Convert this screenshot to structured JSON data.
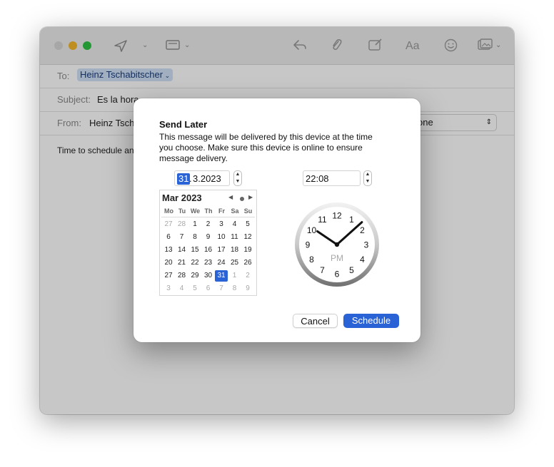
{
  "compose": {
    "to_label": "To:",
    "to_recipient": "Heinz Tschabitscher",
    "subject_label": "Subject:",
    "subject_value": "Es la hora",
    "from_label": "From:",
    "from_value": "Heinz Tsch",
    "from_account_suffix": "one",
    "body_preview": "Time to schedule an"
  },
  "dialog": {
    "title": "Send Later",
    "message": "This message will be delivered by this device at the time you choose. Make sure this device is online to ensure message delivery.",
    "date_day": "31",
    "date_sep": ".",
    "date_rest": " 3.2023",
    "time_value": "22:08",
    "cancel_label": "Cancel",
    "schedule_label": "Schedule"
  },
  "calendar": {
    "month_label": "Mar 2023",
    "weekdays": [
      "Mo",
      "Tu",
      "We",
      "Th",
      "Fr",
      "Sa",
      "Su"
    ],
    "weeks": [
      [
        "27",
        "28",
        "1",
        "2",
        "3",
        "4",
        "5"
      ],
      [
        "6",
        "7",
        "8",
        "9",
        "10",
        "11",
        "12"
      ],
      [
        "13",
        "14",
        "15",
        "16",
        "17",
        "18",
        "19"
      ],
      [
        "20",
        "21",
        "22",
        "23",
        "24",
        "25",
        "26"
      ],
      [
        "27",
        "28",
        "29",
        "30",
        "31",
        "1",
        "2"
      ],
      [
        "3",
        "4",
        "5",
        "6",
        "7",
        "8",
        "9"
      ]
    ],
    "selected": "31"
  },
  "clock": {
    "numbers": [
      "12",
      "1",
      "2",
      "3",
      "4",
      "5",
      "6",
      "7",
      "8",
      "9",
      "10",
      "11"
    ],
    "period": "PM",
    "hour": 10,
    "minute": 8
  },
  "colors": {
    "accent": "#2a63d6",
    "traffic_close": "#d6d6d6",
    "traffic_minimize": "#f4b72a",
    "traffic_zoom": "#2fc244"
  }
}
